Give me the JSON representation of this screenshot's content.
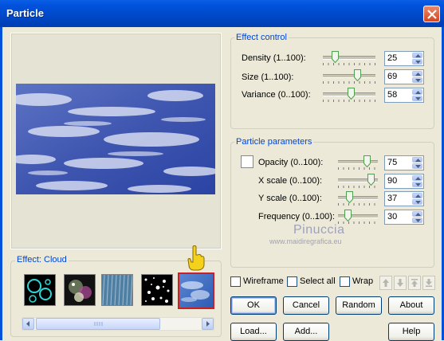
{
  "window": {
    "title": "Particle"
  },
  "preview": {
    "effect_label": "Effect: Cloud"
  },
  "effect_control": {
    "legend": "Effect control",
    "rows": [
      {
        "label": "Density (1..100):",
        "value": "25",
        "slider_fraction": 0.2
      },
      {
        "label": "Size (1..100):",
        "value": "69",
        "slider_fraction": 0.68
      },
      {
        "label": "Variance (0..100):",
        "value": "58",
        "slider_fraction": 0.55
      }
    ]
  },
  "particle_parameters": {
    "legend": "Particle parameters",
    "rows": [
      {
        "label": "Opacity (0..100):",
        "value": "75",
        "slider_fraction": 0.78
      },
      {
        "label": "X scale (0..100):",
        "value": "90",
        "slider_fraction": 0.9
      },
      {
        "label": "Y scale (0..100):",
        "value": "37",
        "slider_fraction": 0.25
      },
      {
        "label": "Frequency (0..100):",
        "value": "30",
        "slider_fraction": 0.2
      }
    ]
  },
  "options": {
    "wireframe": "Wireframe",
    "select_all": "Select all",
    "wrap": "Wrap"
  },
  "buttons": {
    "ok": "OK",
    "cancel": "Cancel",
    "random": "Random",
    "about": "About",
    "load": "Load...",
    "add": "Add...",
    "help": "Help"
  },
  "watermark": {
    "line1": "Pinuccia",
    "line2": "www.maidiregrafica.eu"
  },
  "thumbnails": [
    "bubbles",
    "sparkle-bubbles",
    "rain",
    "snow",
    "cloud"
  ],
  "selected_thumbnail": 4,
  "colors": {
    "title_bar": "#0052dc",
    "group_legend": "#0046d5",
    "selected_border": "#cc1f1f"
  }
}
